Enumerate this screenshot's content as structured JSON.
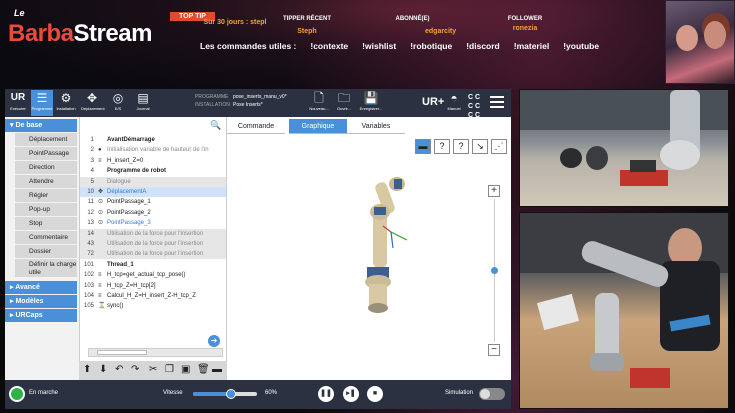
{
  "overlay": {
    "logo_le": "Le",
    "logo_part1": "Barba",
    "logo_part2": "Stream",
    "top_tip": "TOP TIP",
    "stats": [
      {
        "header": "",
        "value": "Sur 30 jours : stepl"
      },
      {
        "header": "TIPPER RÉCENT",
        "value": "Steph"
      },
      {
        "header": "ABONNÉ(E)",
        "value": "edgarcity"
      },
      {
        "header": "FOLLOWER",
        "value": "ronezia"
      }
    ],
    "commands": [
      "Les commandes utiles :",
      "!contexte",
      "!wishlist",
      "!robotique",
      "!discord",
      "!materiel",
      "!youtube"
    ]
  },
  "toolbar": {
    "items": [
      {
        "label": "Exécuter",
        "icon": "ur-logo-icon"
      },
      {
        "label": "Programme",
        "icon": "program-icon",
        "active": true
      },
      {
        "label": "Installation",
        "icon": "installation-icon"
      },
      {
        "label": "Déplacement",
        "icon": "move-icon"
      },
      {
        "label": "E/S",
        "icon": "io-icon"
      },
      {
        "label": "Journal",
        "icon": "log-icon"
      }
    ],
    "program_key": "PROGRAMME",
    "program_value": "pose_inserts_manu_v0*",
    "installation_key": "INSTALLATION",
    "installation_value": "Pose Inserts*",
    "file_buttons": [
      "Nouveau...",
      "Ouvrir...",
      "Enregistrer..."
    ],
    "manual_label": "Manuel",
    "ccc": [
      "C C",
      "C C",
      "C C"
    ]
  },
  "sidebar": {
    "sections": [
      "De base",
      "Avancé",
      "Modèles",
      "URCaps"
    ],
    "items": [
      "Déplacement",
      "PointPassage",
      "Direction",
      "Attendre",
      "Régler",
      "Pop-up",
      "Stop",
      "Commentaire",
      "Dossier",
      "Définir la charge utile"
    ]
  },
  "tree": [
    {
      "n": "1",
      "text": "AvantDémarrage",
      "style": "b"
    },
    {
      "n": "2",
      "text": "Initialisation variable de hauteur de l'in",
      "style": "g2",
      "icon": "●"
    },
    {
      "n": "3",
      "text": "H_insert_Z=0",
      "icon": "≡"
    },
    {
      "n": "4",
      "text": "Programme de robot",
      "style": "b"
    },
    {
      "n": "5",
      "text": "Dialogue",
      "style": "g"
    },
    {
      "n": "10",
      "text": "DéplacementA",
      "style": "s sel",
      "icon": "✥"
    },
    {
      "n": "11",
      "text": "PointPassage_1",
      "icon": "⊙"
    },
    {
      "n": "12",
      "text": "PointPassage_2",
      "icon": "⊙"
    },
    {
      "n": "13",
      "text": "PointPassage_3",
      "style": "s",
      "icon": "⊙"
    },
    {
      "n": "14",
      "text": "Utilisation de la force pour l'insertion",
      "style": "g"
    },
    {
      "n": "43",
      "text": "Utilisation de la force pour l'insertion",
      "style": "g"
    },
    {
      "n": "72",
      "text": "Utilisation de la force pour l'insertion",
      "style": "g"
    },
    {
      "n": "101",
      "text": "Thread_1",
      "style": "b"
    },
    {
      "n": "102",
      "text": "H_tcp=get_actual_tcp_pose()",
      "icon": "≡"
    },
    {
      "n": "103",
      "text": "H_tcp_Z=H_tcp[2]",
      "icon": "≡"
    },
    {
      "n": "104",
      "text": "Calcul_H_Z=H_insert_Z-H_tcp_Z",
      "icon": "≡"
    },
    {
      "n": "105",
      "text": "sync()",
      "icon": "⌛"
    }
  ],
  "tabs": [
    "Commande",
    "Graphique",
    "Variables"
  ],
  "view_buttons": [
    "▬",
    "?",
    "?",
    "↘",
    "⋰"
  ],
  "zoom": {
    "plus": "+",
    "minus": "−"
  },
  "bottom": {
    "run_status": "En marche",
    "speed_label": "Vitesse",
    "speed_percent": "60%",
    "speed_value": 0.6,
    "simulation_label": "Simulation"
  }
}
